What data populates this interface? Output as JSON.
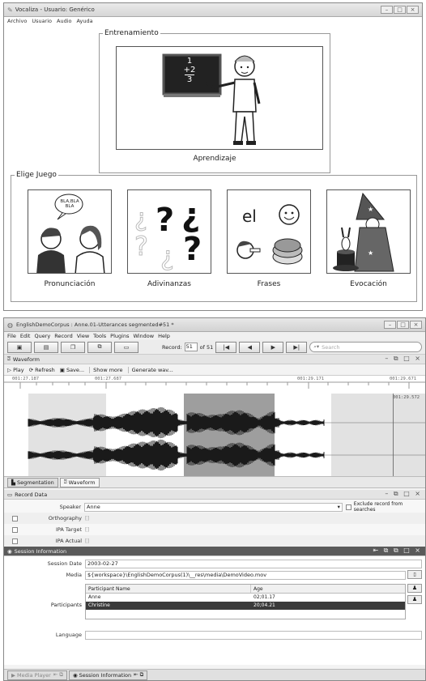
{
  "vocaliza": {
    "title": "Vocaliza - Usuario: Genérico",
    "menu": [
      "Archivo",
      "Usuario",
      "Audio",
      "Ayuda"
    ],
    "training_legend": "Entrenamiento",
    "training_caption": "Aprendizaje",
    "games_legend": "Elige Juego",
    "games": [
      {
        "label": "Pronunciación"
      },
      {
        "label": "Adivinanzas"
      },
      {
        "label": "Frases"
      },
      {
        "label": "Evocación"
      }
    ],
    "bubble_text": "BLA,BLA BLA",
    "blackboard": [
      "1",
      "+2",
      "3"
    ],
    "frases_word": "el"
  },
  "phon": {
    "title": "EnglishDemoCorpus : Anne.01-Utterances segmented#51 *",
    "menu": [
      "File",
      "Edit",
      "Query",
      "Record",
      "View",
      "Tools",
      "Plugins",
      "Window",
      "Help"
    ],
    "record_label": "Record:",
    "record_value": "51",
    "record_total": "of 51",
    "search_placeholder": "Search",
    "waveform": {
      "title": "Waveform",
      "play": "Play",
      "refresh": "Refresh",
      "save": "Save...",
      "show_more": "Show more",
      "generate": "Generate wav...",
      "times": [
        "001:27.187",
        "001:27.687",
        "001:29.171",
        "001:29.671"
      ],
      "cursor_time": "001:29.572"
    },
    "tabs": [
      "Segmentation",
      "Waveform"
    ],
    "record_data": {
      "title": "Record Data",
      "speaker_label": "Speaker",
      "speaker_value": "Anne",
      "exclude_label": "Exclude record from searches",
      "tiers": [
        {
          "label": "Orthography",
          "value": "[]"
        },
        {
          "label": "IPA Target",
          "value": "[]"
        },
        {
          "label": "IPA Actual",
          "value": "[]"
        }
      ]
    },
    "session": {
      "title": "Session Information",
      "date_label": "Session Date",
      "date_value": "2003-02-27",
      "media_label": "Media",
      "media_value": "${workspace}\\EnglishDemoCorpus(1)\\__res\\media\\DemoVideo.mov",
      "participants_label": "Participants",
      "columns": [
        "Participant Name",
        "Age"
      ],
      "participants": [
        {
          "name": "Anne",
          "age": "02;01.17"
        },
        {
          "name": "Christine",
          "age": "20;04.21"
        }
      ],
      "language_label": "Language"
    },
    "bottom_tabs": [
      "Media Player",
      "Session Information"
    ]
  }
}
